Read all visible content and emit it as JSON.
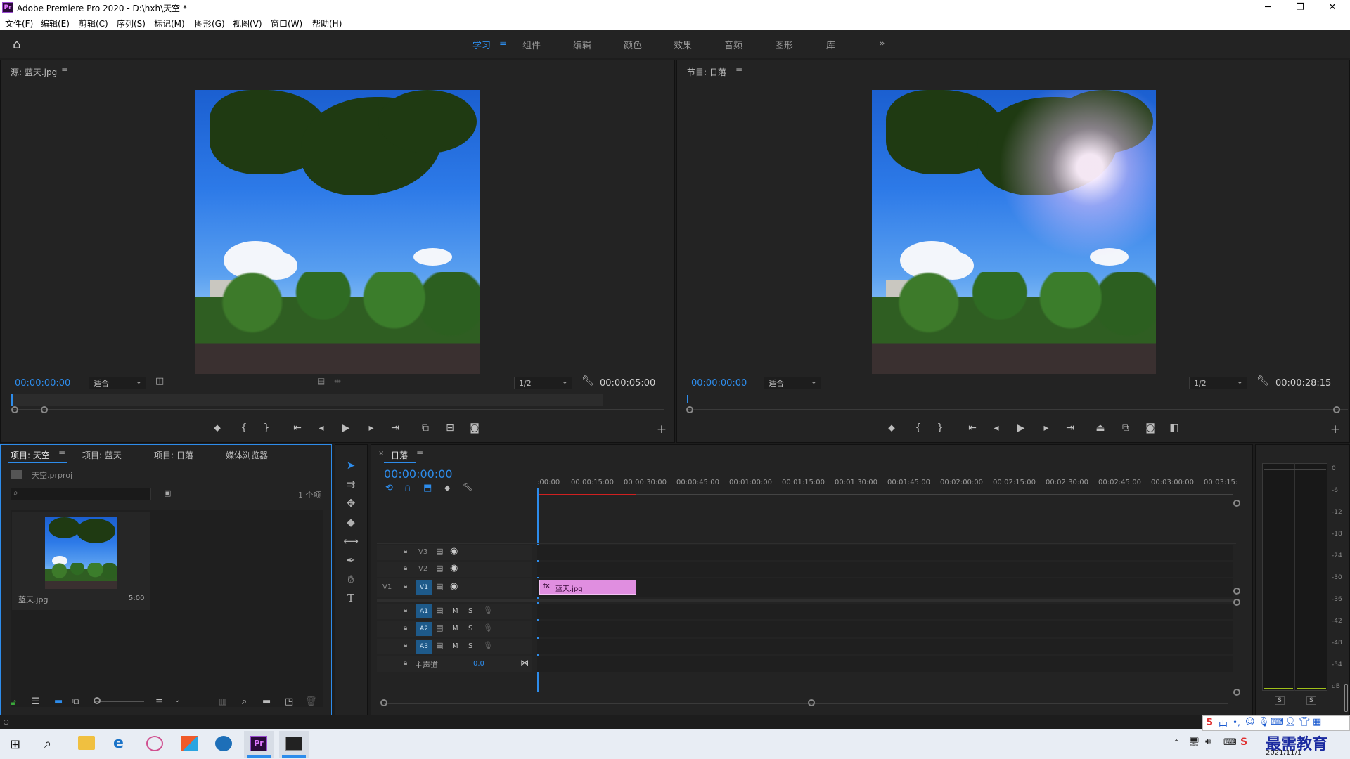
{
  "window": {
    "logo": "Pr",
    "title": "Adobe Premiere Pro 2020 - D:\\hxh\\天空 *",
    "controls": [
      "─",
      "❐",
      "✕"
    ]
  },
  "menu": [
    "文件(F)",
    "编辑(E)",
    "剪辑(C)",
    "序列(S)",
    "标记(M)",
    "图形(G)",
    "视图(V)",
    "窗口(W)",
    "帮助(H)"
  ],
  "workspaces": {
    "items": [
      "学习",
      "组件",
      "编辑",
      "颜色",
      "效果",
      "音频",
      "图形",
      "库"
    ],
    "active": "学习",
    "more": "»"
  },
  "source_monitor": {
    "title": "源: 蓝天.jpg",
    "timecode": "00:00:00:00",
    "fit": "适合",
    "resolution": "1/2",
    "duration": "00:00:05:00"
  },
  "program_monitor": {
    "title": "节目: 日落",
    "timecode": "00:00:00:00",
    "fit": "适合",
    "resolution": "1/2",
    "duration": "00:00:28:15"
  },
  "project_panel": {
    "tabs": [
      "项目: 天空",
      "项目: 蓝天",
      "项目: 日落",
      "媒体浏览器"
    ],
    "project_file": "天空.prproj",
    "item_count": "1 个项",
    "items": [
      {
        "name": "蓝天.jpg",
        "duration": "5:00"
      }
    ]
  },
  "timeline": {
    "sequence": "日落",
    "timecode": "00:00:00:00",
    "ruler": [
      ":00:00",
      "00:00:15:00",
      "00:00:30:00",
      "00:00:45:00",
      "00:01:00:00",
      "00:01:15:00",
      "00:01:30:00",
      "00:01:45:00",
      "00:02:00:00",
      "00:02:15:00",
      "00:02:30:00",
      "00:02:45:00",
      "00:03:00:00",
      "00:03:15:"
    ],
    "video_tracks": [
      "V3",
      "V2",
      "V1"
    ],
    "source_patch": "V1",
    "audio_tracks": [
      "A1",
      "A2",
      "A3"
    ],
    "mute_label": "M",
    "solo_label": "S",
    "master_label": "主声道",
    "master_value": "0.0",
    "clip_name": "蓝天.jpg",
    "clip_fx": "fx"
  },
  "audio_meter": {
    "scale": [
      "0",
      "-6",
      "-12",
      "-18",
      "-24",
      "-30",
      "-36",
      "-42",
      "-48",
      "-54",
      "dB"
    ],
    "solo": [
      "S",
      "S"
    ]
  },
  "taskbar": {
    "date": "2021/11/1",
    "ime": "中",
    "watermark": "最需教育"
  },
  "colors": {
    "accent": "#2d8ceb",
    "clip": "#e08ee0",
    "playhead": "#2d8ceb",
    "render_bar": "#d02020"
  }
}
